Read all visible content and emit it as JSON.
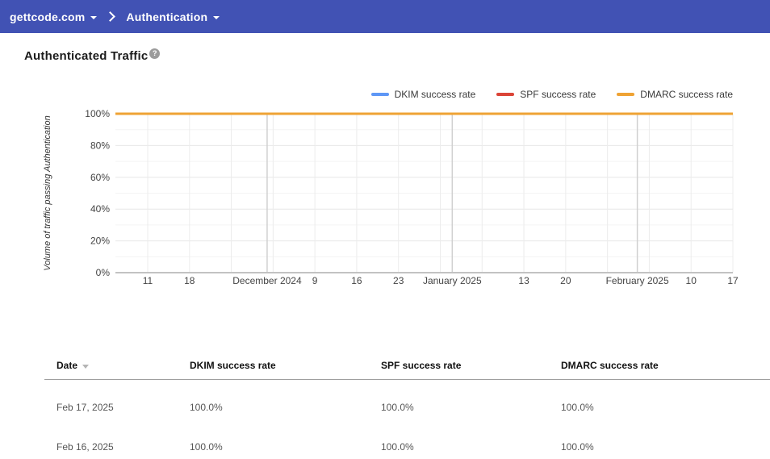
{
  "topbar": {
    "bg_color": "#4152b4",
    "domain_selector": "gettcode.com",
    "section_selector": "Authentication"
  },
  "page": {
    "title": "Authenticated Traffic",
    "help_glyph": "?"
  },
  "chart_data": {
    "type": "line",
    "title": "Authenticated Traffic",
    "ylabel": "Volume of traffic passing Authentication",
    "xlabel": "",
    "ylim": [
      0,
      100
    ],
    "grid": true,
    "legend_position": "top-right",
    "y_tick_labels": [
      "0%",
      "20%",
      "40%",
      "60%",
      "80%",
      "100%"
    ],
    "x_week_tick_labels": [
      "11",
      "18",
      "",
      "",
      "9",
      "16",
      "23",
      "",
      "",
      "13",
      "20",
      "",
      "",
      "10",
      "17"
    ],
    "x_month_labels": [
      {
        "label": "December 2024",
        "week_index": 2.857
      },
      {
        "label": "January 2025",
        "week_index": 7.286
      },
      {
        "label": "February 2025",
        "week_index": 11.714
      }
    ],
    "series": [
      {
        "name": "DKIM success rate",
        "color": "#5e97f6",
        "values": [
          100,
          100,
          100,
          100,
          100,
          100,
          100,
          100,
          100,
          100,
          100,
          100,
          100,
          100,
          100
        ]
      },
      {
        "name": "SPF success rate",
        "color": "#db4437",
        "values": [
          100,
          100,
          100,
          100,
          100,
          100,
          100,
          100,
          100,
          100,
          100,
          100,
          100,
          100,
          100
        ]
      },
      {
        "name": "DMARC success rate",
        "color": "#efa334",
        "values": [
          100,
          100,
          100,
          100,
          100,
          100,
          100,
          100,
          100,
          100,
          100,
          100,
          100,
          100,
          100
        ]
      }
    ]
  },
  "table": {
    "columns": [
      "Date",
      "DKIM success rate",
      "SPF success rate",
      "DMARC success rate"
    ],
    "sort_column": "Date",
    "rows": [
      [
        "Feb 17, 2025",
        "100.0%",
        "100.0%",
        "100.0%"
      ],
      [
        "Feb 16, 2025",
        "100.0%",
        "100.0%",
        "100.0%"
      ]
    ]
  }
}
